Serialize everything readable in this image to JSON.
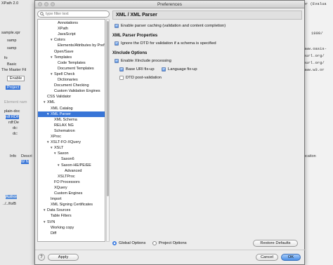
{
  "window": {
    "title": "Preferences"
  },
  "background_left": {
    "rows": [
      "XPath 2.0",
      "sample.xpr",
      "samp",
      "samp",
      "fo",
      "Basic",
      "The Master Fil",
      "Enable",
      "Project",
      "Element nam",
      "plain-doc",
      "rdf:RDF",
      "rdf:De",
      "dc:",
      "dc:",
      "Info",
      "Descri",
      "W N",
      "Author",
      "../../fo/B"
    ]
  },
  "background_right": {
    "rows": [
      "thor (Evalua",
      "1999/",
      "www.oasis-",
      "purl.org/",
      "purl.org/",
      "www.w3.or",
      "ocation"
    ]
  },
  "filter": {
    "placeholder": "type filter text"
  },
  "tree": [
    {
      "label": "Annotations",
      "indent": 4,
      "arrow": ""
    },
    {
      "label": "XPath",
      "indent": 4,
      "arrow": ""
    },
    {
      "label": "JavaScript",
      "indent": 4,
      "arrow": ""
    },
    {
      "label": "Colors",
      "indent": 3,
      "arrow": "▼"
    },
    {
      "label": "Elements/Attributes by Prefix",
      "indent": 4,
      "arrow": ""
    },
    {
      "label": "Open/Save",
      "indent": 3,
      "arrow": ""
    },
    {
      "label": "Templates",
      "indent": 3,
      "arrow": "▼"
    },
    {
      "label": "Code Templates",
      "indent": 4,
      "arrow": ""
    },
    {
      "label": "Document Templates",
      "indent": 4,
      "arrow": ""
    },
    {
      "label": "Spell Check",
      "indent": 3,
      "arrow": "▼"
    },
    {
      "label": "Dictionaries",
      "indent": 4,
      "arrow": ""
    },
    {
      "label": "Document Checking",
      "indent": 3,
      "arrow": ""
    },
    {
      "label": "Custom Validation Engines",
      "indent": 3,
      "arrow": ""
    },
    {
      "label": "CSS Validator",
      "indent": 1,
      "arrow": ""
    },
    {
      "label": "XML",
      "indent": 1,
      "arrow": "▼"
    },
    {
      "label": "XML Catalog",
      "indent": 2,
      "arrow": ""
    },
    {
      "label": "XML Parser",
      "indent": 2,
      "arrow": "▼",
      "selected": true
    },
    {
      "label": "XML Schema",
      "indent": 3,
      "arrow": ""
    },
    {
      "label": "RELAX NG",
      "indent": 3,
      "arrow": ""
    },
    {
      "label": "Schematron",
      "indent": 3,
      "arrow": ""
    },
    {
      "label": "XProc",
      "indent": 2,
      "arrow": ""
    },
    {
      "label": "XSLT-FO-XQuery",
      "indent": 2,
      "arrow": "▼"
    },
    {
      "label": "XSLT",
      "indent": 3,
      "arrow": "▼"
    },
    {
      "label": "Saxon",
      "indent": 4,
      "arrow": "▼"
    },
    {
      "label": "Saxon6",
      "indent": 5,
      "arrow": ""
    },
    {
      "label": "Saxon-HE/PE/EE",
      "indent": 5,
      "arrow": "▼"
    },
    {
      "label": "Advanced",
      "indent": 6,
      "arrow": ""
    },
    {
      "label": "XSLTProc",
      "indent": 4,
      "arrow": ""
    },
    {
      "label": "FO Processors",
      "indent": 3,
      "arrow": ""
    },
    {
      "label": "XQuery",
      "indent": 3,
      "arrow": ""
    },
    {
      "label": "Custom Engines",
      "indent": 3,
      "arrow": ""
    },
    {
      "label": "Import",
      "indent": 2,
      "arrow": ""
    },
    {
      "label": "XML Signing Certificates",
      "indent": 2,
      "arrow": ""
    },
    {
      "label": "Data Sources",
      "indent": 1,
      "arrow": "▼"
    },
    {
      "label": "Table Filters",
      "indent": 2,
      "arrow": ""
    },
    {
      "label": "SVN",
      "indent": 1,
      "arrow": "▼"
    },
    {
      "label": "Working copy",
      "indent": 2,
      "arrow": ""
    },
    {
      "label": "Diff",
      "indent": 2,
      "arrow": ""
    }
  ],
  "page": {
    "header": "XML / XML Parser",
    "enable_caching": {
      "label": "Enable parser caching (validation and content completion)",
      "checked": true
    },
    "parser_props_title": "XML Parser Properties",
    "ignore_dtd": {
      "label": "Ignore the DTD for validation if a schema is specified",
      "checked": true
    },
    "xinclude_title": "XInclude Options",
    "enable_xinclude": {
      "label": "Enable XInclude processing",
      "checked": true
    },
    "base_uri": {
      "label": "Base URI fix-up",
      "checked": true
    },
    "lang_fixup": {
      "label": "Language fix-up",
      "checked": true
    },
    "dtd_post": {
      "label": "DTD post-validation",
      "checked": false
    }
  },
  "footer": {
    "global_options": "Global Options",
    "project_options": "Project Options",
    "restore_defaults": "Restore Defaults",
    "apply": "Apply",
    "cancel": "Cancel",
    "ok": "OK",
    "help": "?"
  },
  "colors": {
    "selection": "#3875d7",
    "primary_button": "#4b8fe6"
  }
}
